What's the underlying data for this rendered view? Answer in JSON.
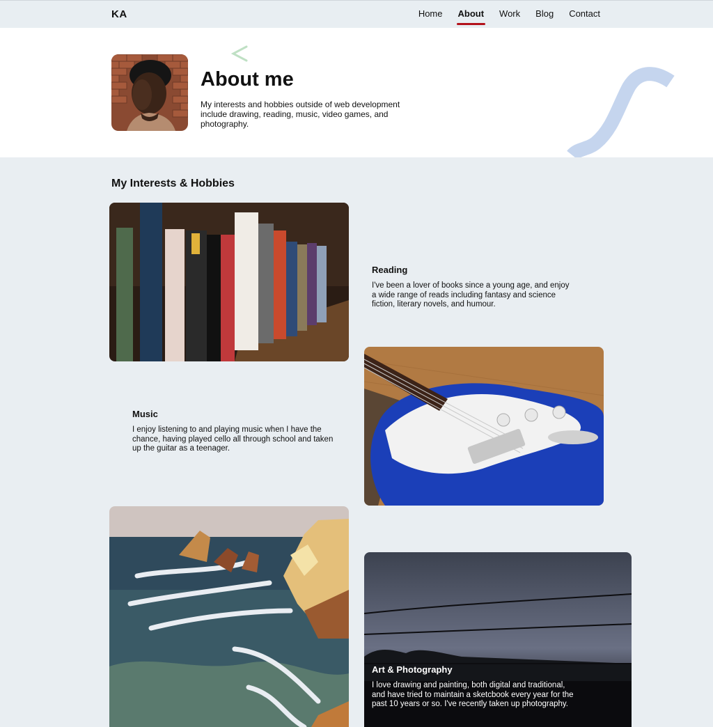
{
  "nav": {
    "logo": "KA",
    "links": [
      {
        "label": "Home",
        "active": false
      },
      {
        "label": "About",
        "active": true
      },
      {
        "label": "Work",
        "active": false
      },
      {
        "label": "Blog",
        "active": false
      },
      {
        "label": "Contact",
        "active": false
      }
    ],
    "active_color": "#b3121b"
  },
  "hero": {
    "title": "About me",
    "description": "My interests and hobbies outside of web development include drawing, reading, music, video games, and photography."
  },
  "interests": {
    "heading": "My Interests & Hobbies",
    "items": [
      {
        "title": "Reading",
        "text": "I've been a lover of books since a young age, and enjoy a wide range of reads including fantasy and science fiction, literary novels, and humour."
      },
      {
        "title": "Music",
        "text": "I enjoy listening to and playing music when I have the chance, having played cello all through school and taken up the guitar as a teenager."
      },
      {
        "title": "Art & Photography",
        "text": "I love drawing and painting, both digital and traditional, and have tried to maintain a sketcbook every year for the past 10 years or so. I've recently taken up photography."
      }
    ]
  },
  "colors": {
    "page_bg": "#e9eef2",
    "hero_bg": "#ffffff",
    "deco_green": "#bfe0c4",
    "deco_blue": "#c5d5ee"
  }
}
